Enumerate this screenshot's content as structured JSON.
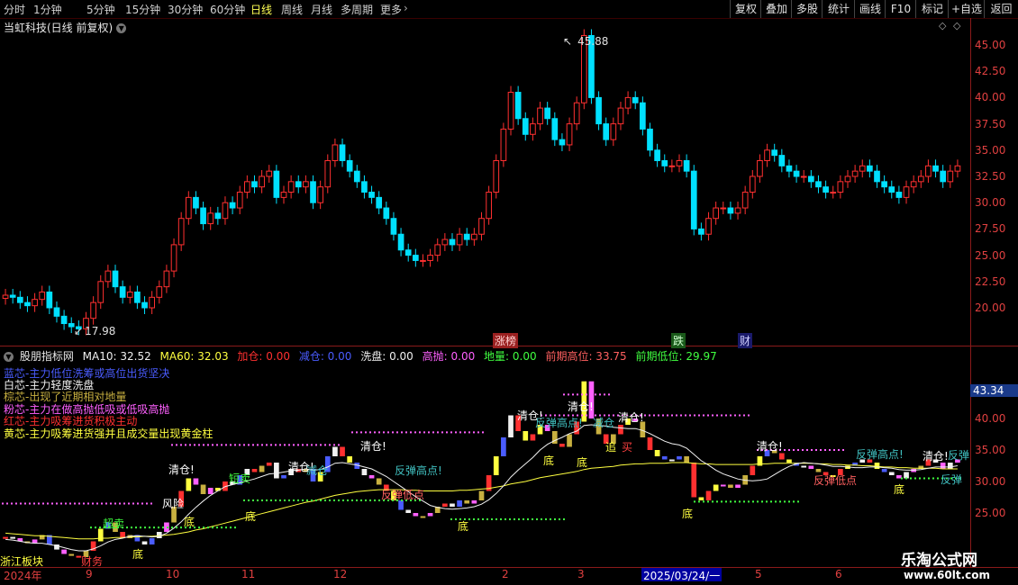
{
  "toolbar": {
    "periods": [
      "分时",
      "1分钟",
      "5分钟",
      "15分钟",
      "30分钟",
      "60分钟",
      "日线",
      "周线",
      "月线",
      "多周期",
      "更多"
    ],
    "active_period": "日线",
    "right_buttons": [
      "复权",
      "叠加",
      "多股",
      "统计",
      "画线",
      "F10",
      "标记",
      "+自选",
      "返回"
    ]
  },
  "chart_header": {
    "title": "当虹科技(日线 前复权)"
  },
  "price_axis": {
    "ticks": [
      "45.00",
      "42.50",
      "40.00",
      "37.50",
      "35.00",
      "32.50",
      "30.00",
      "27.50",
      "25.00",
      "22.50",
      "20.00"
    ]
  },
  "markers": {
    "high": "45.88",
    "low": "17.98"
  },
  "events": [
    "涨榜",
    "跌",
    "财"
  ],
  "indicator": {
    "name": "股朋指标网",
    "ma10": "MA10: 32.52",
    "ma60": "MA60: 32.03",
    "jiacang": "加仓: 0.00",
    "jiancang": "减仓: 0.00",
    "xipan": "洗盘: 0.00",
    "gaopao": "高抛: 0.00",
    "diliang": "地量: 0.00",
    "prev_high": "前期高位: 33.75",
    "prev_low": "前期低位: 29.97",
    "current_price": "43.34",
    "ticks": [
      "40.00",
      "35.00",
      "30.00",
      "25.00"
    ],
    "legend": [
      {
        "text": "蓝芯-主力低位洗筹或高位出货坚决",
        "color": "#4a5cff"
      },
      {
        "text": "白芯-主力轻度洗盘",
        "color": "#f0f0f0"
      },
      {
        "text": "棕芯-出现了近期相对地量",
        "color": "#c8b040"
      },
      {
        "text": "粉芯-主力在做高抛低吸或低吸高抛",
        "color": "#ff60ff"
      },
      {
        "text": "红芯-主力吸筹进货积极主动",
        "color": "#ff3030"
      },
      {
        "text": "黄芯-主力吸筹进货强并且成交量出现黄金柱",
        "color": "#ffff40"
      }
    ],
    "annotations": [
      {
        "text": "清仓!",
        "color": "#ffffff"
      },
      {
        "text": "反弹高点!",
        "color": "#40c0c0"
      },
      {
        "text": "反弹低点",
        "color": "#ff6060"
      },
      {
        "text": "底",
        "color": "#ffff40"
      },
      {
        "text": "减仓",
        "color": "#40c0c0"
      },
      {
        "text": "追",
        "color": "#ffff40"
      },
      {
        "text": "买",
        "color": "#ff4040"
      },
      {
        "text": "风险",
        "color": "#ffffff"
      },
      {
        "text": "短卖",
        "color": "#40ff40"
      },
      {
        "text": "超卖",
        "color": "#40ff40"
      },
      {
        "text": "反弹",
        "color": "#40c0c0"
      },
      {
        "text": "浙江板块",
        "color": "#ffff40"
      },
      {
        "text": "财务",
        "color": "#ff4040"
      }
    ]
  },
  "x_axis": {
    "labels": [
      "2024年",
      "9",
      "10",
      "11",
      "12",
      "2",
      "3",
      "5",
      "6"
    ],
    "cursor_date": "2025/03/24/一"
  },
  "watermark": {
    "line1": "乐淘公式网",
    "line2": "www.60lt.com"
  },
  "chart_data": {
    "type": "candlestick",
    "ylim": [
      17.5,
      46.5
    ],
    "series": [
      {
        "name": "K线",
        "values": [
          21.2,
          21.0,
          20.5,
          20.2,
          20.8,
          21.5,
          20.0,
          19.2,
          18.5,
          18.2,
          18.0,
          19.0,
          20.5,
          22.5,
          23.5,
          22.0,
          21.0,
          21.5,
          20.5,
          20.0,
          21.0,
          22.0,
          23.5,
          26.0,
          28.5,
          30.5,
          29.5,
          28.0,
          29.0,
          28.5,
          30.0,
          29.5,
          31.0,
          32.0,
          31.5,
          32.5,
          33.0,
          30.5,
          31.0,
          32.0,
          31.5,
          32.0,
          30.0,
          31.5,
          34.0,
          35.5,
          34.0,
          33.0,
          32.0,
          31.0,
          30.5,
          29.5,
          28.5,
          27.0,
          25.5,
          25.0,
          24.5,
          24.5,
          25.0,
          26.0,
          26.5,
          26.0,
          27.0,
          26.5,
          27.0,
          28.5,
          31.0,
          34.0,
          37.0,
          40.5,
          38.0,
          36.5,
          37.5,
          39.0,
          38.0,
          36.0,
          35.5,
          37.5,
          39.5,
          45.9,
          40.0,
          37.5,
          36.0,
          37.5,
          39.0,
          40.0,
          39.5,
          37.0,
          35.0,
          34.0,
          33.5,
          33.5,
          34.0,
          33.0,
          27.5,
          27.0,
          28.5,
          29.5,
          29.5,
          29.0,
          29.5,
          31.0,
          32.5,
          34.0,
          35.0,
          34.5,
          33.5,
          33.0,
          32.5,
          32.5,
          32.0,
          31.5,
          31.0,
          31.0,
          32.0,
          32.5,
          33.0,
          33.5,
          33.0,
          32.0,
          31.5,
          31.0,
          30.5,
          31.5,
          32.0,
          32.5,
          33.5,
          33.0,
          32.0,
          33.0,
          33.5
        ]
      }
    ],
    "ma10": [
      20.8,
      20.7,
      20.5,
      20.3,
      20.2,
      20.2,
      20.0,
      19.8,
      19.5,
      19.2,
      19.0,
      19.0,
      19.3,
      19.8,
      20.4,
      20.8,
      21.0,
      21.3,
      21.4,
      21.3,
      21.2,
      21.3,
      21.8,
      22.6,
      23.6,
      24.8,
      25.9,
      26.9,
      27.8,
      28.5,
      29.2,
      29.5,
      29.8,
      30.1,
      30.4,
      30.8,
      31.2,
      31.3,
      31.5,
      31.7,
      31.8,
      32.0,
      31.8,
      31.9,
      32.3,
      32.9,
      33.0,
      32.8,
      32.6,
      32.3,
      32.0,
      31.4,
      30.8,
      30.0,
      29.2,
      28.4,
      27.6,
      26.9,
      26.2,
      25.9,
      25.7,
      25.6,
      25.7,
      25.8,
      26.0,
      26.4,
      27.1,
      28.1,
      29.3,
      30.7,
      31.8,
      32.8,
      33.8,
      35.0,
      35.9,
      36.5,
      37.0,
      37.6,
      38.0,
      38.9,
      39.0,
      38.9,
      38.8,
      38.6,
      38.5,
      38.4,
      38.4,
      38.1,
      37.6,
      37.0,
      36.4,
      36.0,
      35.8,
      35.3,
      34.3,
      33.3,
      32.6,
      31.8,
      31.2,
      30.8,
      30.4,
      30.2,
      30.1,
      30.2,
      30.4,
      31.1,
      31.8,
      32.4,
      32.8,
      33.0,
      32.9,
      32.8,
      32.6,
      32.4,
      32.4,
      32.3,
      32.2,
      32.2,
      32.3,
      32.3,
      32.2,
      32.1,
      31.9,
      31.8,
      31.8,
      31.9,
      32.1,
      32.3,
      32.3,
      32.3,
      32.5
    ],
    "ma60": [
      21.8,
      21.7,
      21.6,
      21.5,
      21.4,
      21.4,
      21.3,
      21.2,
      21.1,
      21.0,
      20.9,
      20.9,
      20.9,
      21.0,
      21.0,
      21.1,
      21.1,
      21.2,
      21.2,
      21.3,
      21.3,
      21.4,
      21.5,
      21.6,
      21.8,
      22.0,
      22.3,
      22.5,
      22.8,
      23.1,
      23.4,
      23.7,
      24.0,
      24.3,
      24.6,
      24.9,
      25.2,
      25.5,
      25.8,
      26.1,
      26.4,
      26.7,
      26.9,
      27.2,
      27.5,
      27.8,
      28.0,
      28.2,
      28.4,
      28.5,
      28.6,
      28.7,
      28.7,
      28.7,
      28.7,
      28.6,
      28.6,
      28.5,
      28.5,
      28.5,
      28.5,
      28.5,
      28.6,
      28.6,
      28.7,
      28.8,
      28.9,
      29.1,
      29.3,
      29.6,
      29.8,
      30.0,
      30.3,
      30.6,
      30.8,
      31.0,
      31.2,
      31.4,
      31.6,
      31.9,
      32.1,
      32.2,
      32.3,
      32.4,
      32.6,
      32.7,
      32.8,
      32.8,
      32.9,
      32.9,
      32.9,
      33.0,
      33.0,
      33.0,
      32.9,
      32.8,
      32.8,
      32.7,
      32.7,
      32.7,
      32.7,
      32.7,
      32.7,
      32.8,
      32.8,
      32.9,
      32.9,
      32.9,
      32.9,
      32.9,
      32.9,
      32.8,
      32.8,
      32.7,
      32.7,
      32.6,
      32.6,
      32.5,
      32.5,
      32.4,
      32.3,
      32.3,
      32.2,
      32.2,
      32.1,
      32.1,
      32.1,
      32.1,
      32.0,
      32.0,
      32.0
    ]
  }
}
